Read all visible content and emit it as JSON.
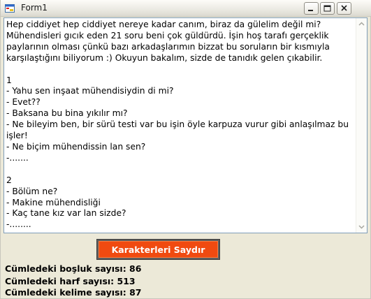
{
  "window": {
    "title": "Form1"
  },
  "textbox": {
    "text": "Hep ciddiyet hep ciddiyet nereye kadar canım, biraz da gülelim değil mi?\nMühendisleri gıcık eden 21 soru beni çok güldürdü. İşin hoş tarafı gerçeklik paylarının olması çünkü bazı arkadaşlarımın bizzat bu soruların bir kısmıyla karşılaştığını biliyorum :) Okuyun bakalım, sizde de tanıdık gelen çıkabilir.\n\n1\n- Yahu sen inşaat mühendisiydin di mi?\n- Evet??\n- Baksana bu bina yıkılır mı?\n- Ne bileyim ben, bir sürü testi var bu işin öyle karpuza vurur gibi anlaşılmaz bu işler!\n- Ne biçim mühendissin lan sen?\n-.......\n\n2\n- Bölüm ne?\n- Makine mühendisliği\n- Kaç tane kız var lan sizde?\n-........"
  },
  "button": {
    "label": "Karakterleri Saydır"
  },
  "results": {
    "bosluk": "Cümledeki boşluk sayısı: 86",
    "harf": "Cümledeki harf sayısı: 513",
    "kelime": "Cümledeki kelime sayısı: 87"
  },
  "colors": {
    "button_fill": "#f04a10",
    "window_bg": "#ece9d8",
    "textbox_border": "#7f9db9"
  }
}
